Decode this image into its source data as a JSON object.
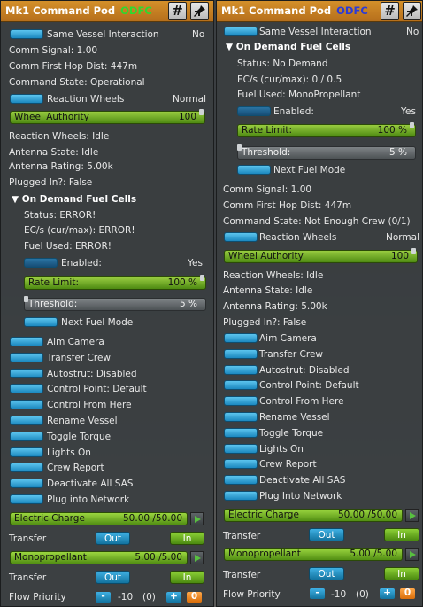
{
  "left": {
    "title": "Mk1 Command Pod",
    "tag": "ODFC",
    "same_vessel": {
      "label": "Same Vessel Interaction",
      "value": "No"
    },
    "comm_signal": "Comm Signal: 1.00",
    "comm_hop": "Comm First Hop Dist: 447m",
    "command_state": "Command State: Operational",
    "reaction_wheels": {
      "label": "Reaction Wheels",
      "value": "Normal"
    },
    "wheel_authority": {
      "label": "Wheel Authority",
      "value": "100"
    },
    "rw_status": "Reaction Wheels: Idle",
    "antenna_state": "Antenna State: Idle",
    "antenna_rating": "Antenna Rating: 5.00k",
    "plugged_in": "Plugged In?: False",
    "odfc_header": "On Demand Fuel Cells",
    "odfc_status": "Status: ERROR!",
    "odfc_ec": "EC/s (cur/max): ERROR!",
    "odfc_fuel": "Fuel Used: ERROR!",
    "enabled": {
      "label": "Enabled:",
      "value": "Yes"
    },
    "rate_limit": {
      "label": "Rate Limit:",
      "value": "100 %"
    },
    "threshold": {
      "label": "Threshold:",
      "value": "5 %"
    },
    "next_fuel_mode": "Next Fuel Mode",
    "actions": [
      "Aim Camera",
      "Transfer Crew",
      "Autostrut: Disabled",
      "Control Point: Default",
      "Control From Here",
      "Rename Vessel",
      "Toggle Torque",
      "Lights On",
      "Crew Report",
      "Deactivate All SAS",
      "Plug into Network"
    ],
    "electric_charge": {
      "label": "Electric Charge",
      "value": "50.00 /50.00"
    },
    "transfer_label": "Transfer",
    "out_label": "Out",
    "in_label": "In",
    "monopropellant": {
      "label": "Monopropellant",
      "value": "5.00 /5.00"
    },
    "transfer_label_2": "Transfer",
    "out_label_2": "Out",
    "in_label_2": "In",
    "flow_priority": {
      "label": "Flow Priority",
      "minus": "-",
      "value": "-10",
      "extra": "(0)",
      "plus": "+",
      "zero": "0"
    }
  },
  "right": {
    "title": "Mk1 Command Pod",
    "tag": "ODFC",
    "same_vessel": {
      "label": "Same Vessel Interaction",
      "value": "No"
    },
    "odfc_header": "On Demand Fuel Cells",
    "odfc_status": "Status: No Demand",
    "odfc_ec": "EC/s (cur/max): 0 / 0.5",
    "odfc_fuel": "Fuel Used: MonoPropellant",
    "enabled": {
      "label": "Enabled:",
      "value": "Yes"
    },
    "rate_limit": {
      "label": "Rate Limit:",
      "value": "100 %"
    },
    "threshold": {
      "label": "Threshold:",
      "value": "5 %"
    },
    "next_fuel_mode": "Next Fuel Mode",
    "comm_signal": "Comm Signal: 1.00",
    "comm_hop": "Comm First Hop Dist: 447m",
    "command_state": "Command State: Not Enough Crew (0/1)",
    "reaction_wheels": {
      "label": "Reaction Wheels",
      "value": "Normal"
    },
    "wheel_authority": {
      "label": "Wheel Authority",
      "value": "100"
    },
    "rw_status": "Reaction Wheels: Idle",
    "antenna_state": "Antenna State: Idle",
    "antenna_rating": "Antenna Rating: 5.00k",
    "plugged_in": "Plugged In?: False",
    "actions": [
      "Aim Camera",
      "Transfer Crew",
      "Autostrut: Disabled",
      "Control Point: Default",
      "Control From Here",
      "Rename Vessel",
      "Toggle Torque",
      "Lights On",
      "Crew Report",
      "Deactivate All SAS",
      "Plug Into Network"
    ],
    "electric_charge": {
      "label": "Electric Charge",
      "value": "50.00 /50.00"
    },
    "transfer_label": "Transfer",
    "out_label": "Out",
    "in_label": "In",
    "monopropellant": {
      "label": "Monopropellant",
      "value": "5.00 /5.00"
    },
    "transfer_label_2": "Transfer",
    "out_label_2": "Out",
    "in_label_2": "In",
    "flow_priority": {
      "label": "Flow Priority",
      "minus": "-",
      "value": "-10",
      "extra": "(0)",
      "plus": "+",
      "zero": "0"
    }
  },
  "icons": {
    "hash": "#",
    "pin": "📌"
  },
  "colors": {
    "title_bar": "#c7801f",
    "tag_left": "#2fd82f",
    "tag_right": "#2a3bd8",
    "button": "#3aa6d8",
    "slider": "#7bb52c"
  }
}
